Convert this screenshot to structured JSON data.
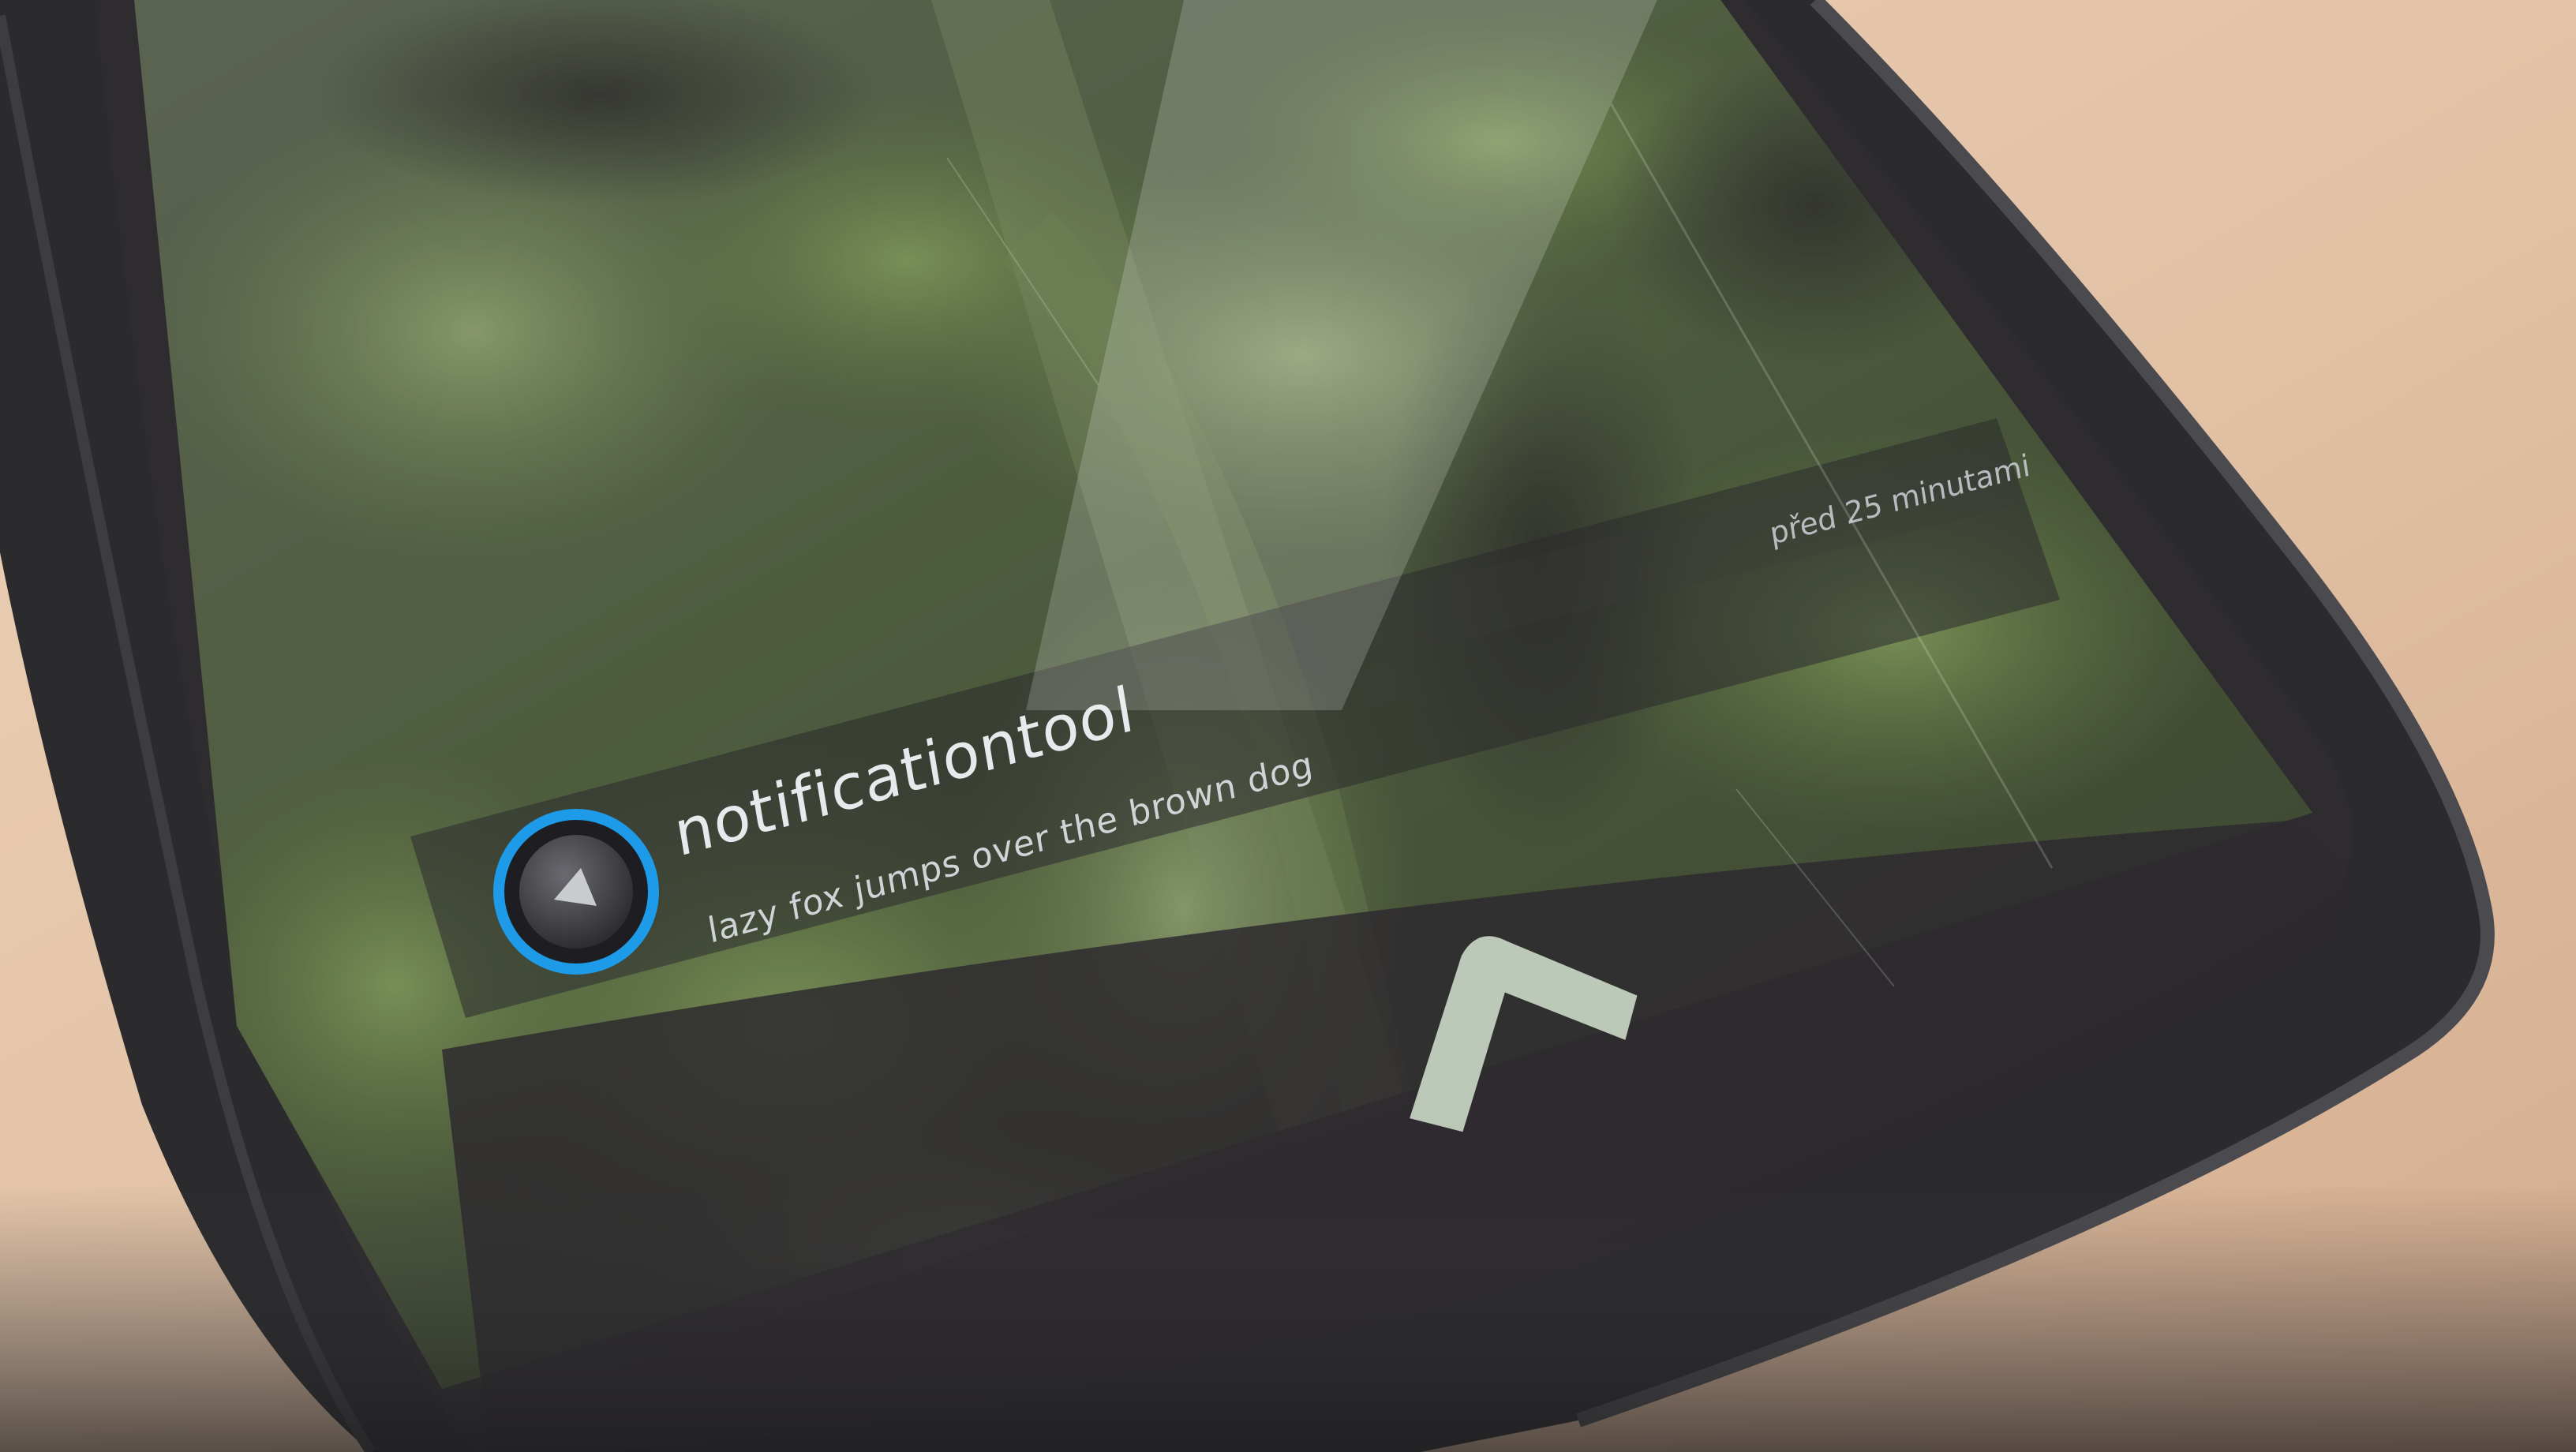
{
  "notification": {
    "app_name": "notificationtool",
    "message": "lazy fox jumps over the brown dog",
    "timestamp": "před 25 minutami",
    "icon": "app-circle-icon"
  },
  "lockscreen": {
    "unlock_icon": "chevron-up-icon"
  },
  "colors": {
    "icon_ring": "#1e9be8",
    "phone_body": "#2a2a2c",
    "desk": "#e2c3a8"
  }
}
